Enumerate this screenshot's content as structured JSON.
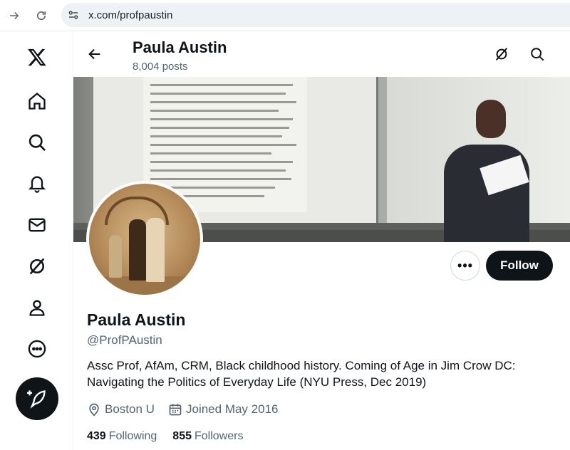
{
  "browser": {
    "url": "x.com/profpaustin",
    "icons": [
      "forward-icon",
      "reload-icon",
      "site-settings-icon"
    ]
  },
  "rail": {
    "items": [
      "x-logo",
      "home-icon",
      "search-icon",
      "notifications-icon",
      "messages-icon",
      "grok-icon",
      "profile-icon",
      "more-icon"
    ],
    "post_icon": "compose-icon"
  },
  "header": {
    "name": "Paula Austin",
    "post_count": "8,004 posts"
  },
  "profile": {
    "name": "Paula Austin",
    "handle": "@ProfPAustin",
    "bio": "Assc Prof, AfAm, CRM, Black childhood history. Coming of Age in Jim Crow DC: Navigating the Politics of Everyday Life (NYU Press, Dec 2019)",
    "location": "Boston U",
    "joined": "Joined May 2016",
    "following_count": "439",
    "following_label": "Following",
    "followers_count": "855",
    "followers_label": "Followers"
  },
  "actions": {
    "more_label": "•••",
    "follow_label": "Follow"
  },
  "colors": {
    "text": "#0f1419",
    "muted": "#536471",
    "button": "#0f1419"
  }
}
